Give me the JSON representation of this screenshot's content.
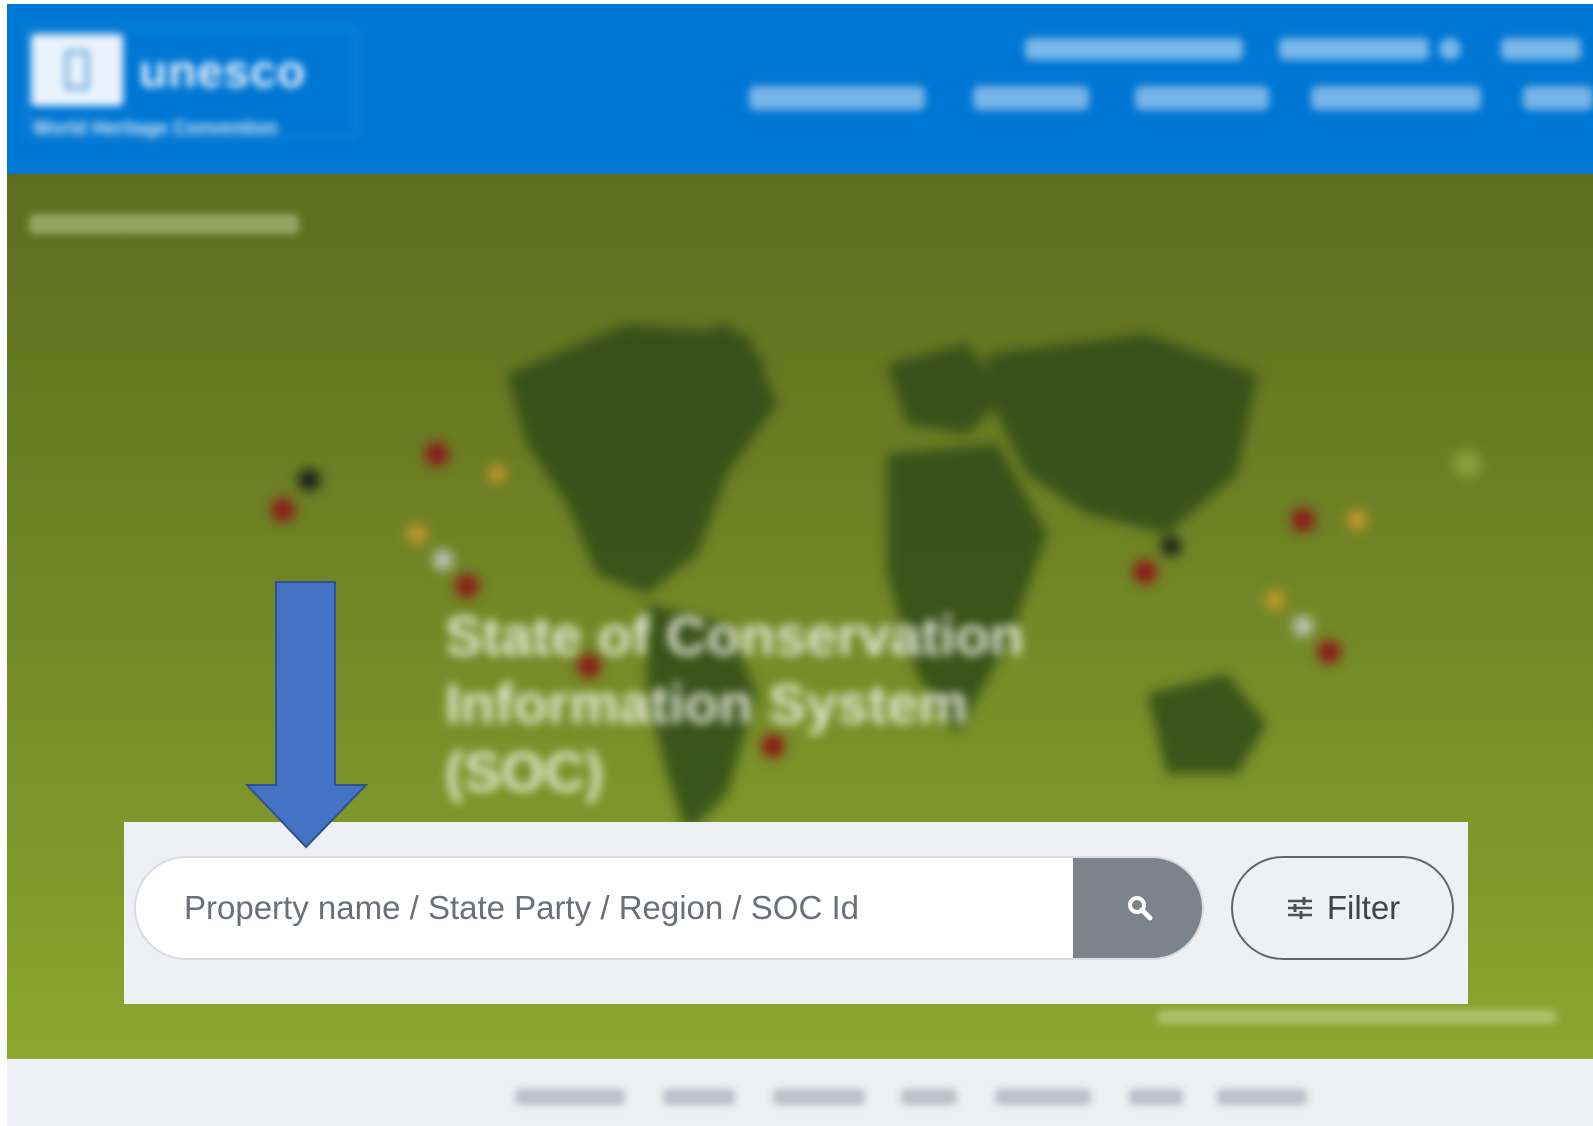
{
  "header": {
    "logo_text": "unesco",
    "logo_subtitle": "World Heritage Convention",
    "brand_color": "#0077d4"
  },
  "hero": {
    "title_lines": [
      "State of Conservation",
      "Information System",
      "(SOC)"
    ],
    "background_color": "#7c9429"
  },
  "search": {
    "placeholder": "Property name / State Party / Region / SOC Id",
    "search_icon": "magnifier-icon",
    "filter_icon": "sliders-icon",
    "filter_label": "Filter",
    "button_color": "#7d838b"
  },
  "annotation": {
    "arrow_color": "#4472c4",
    "arrow_direction": "down"
  }
}
